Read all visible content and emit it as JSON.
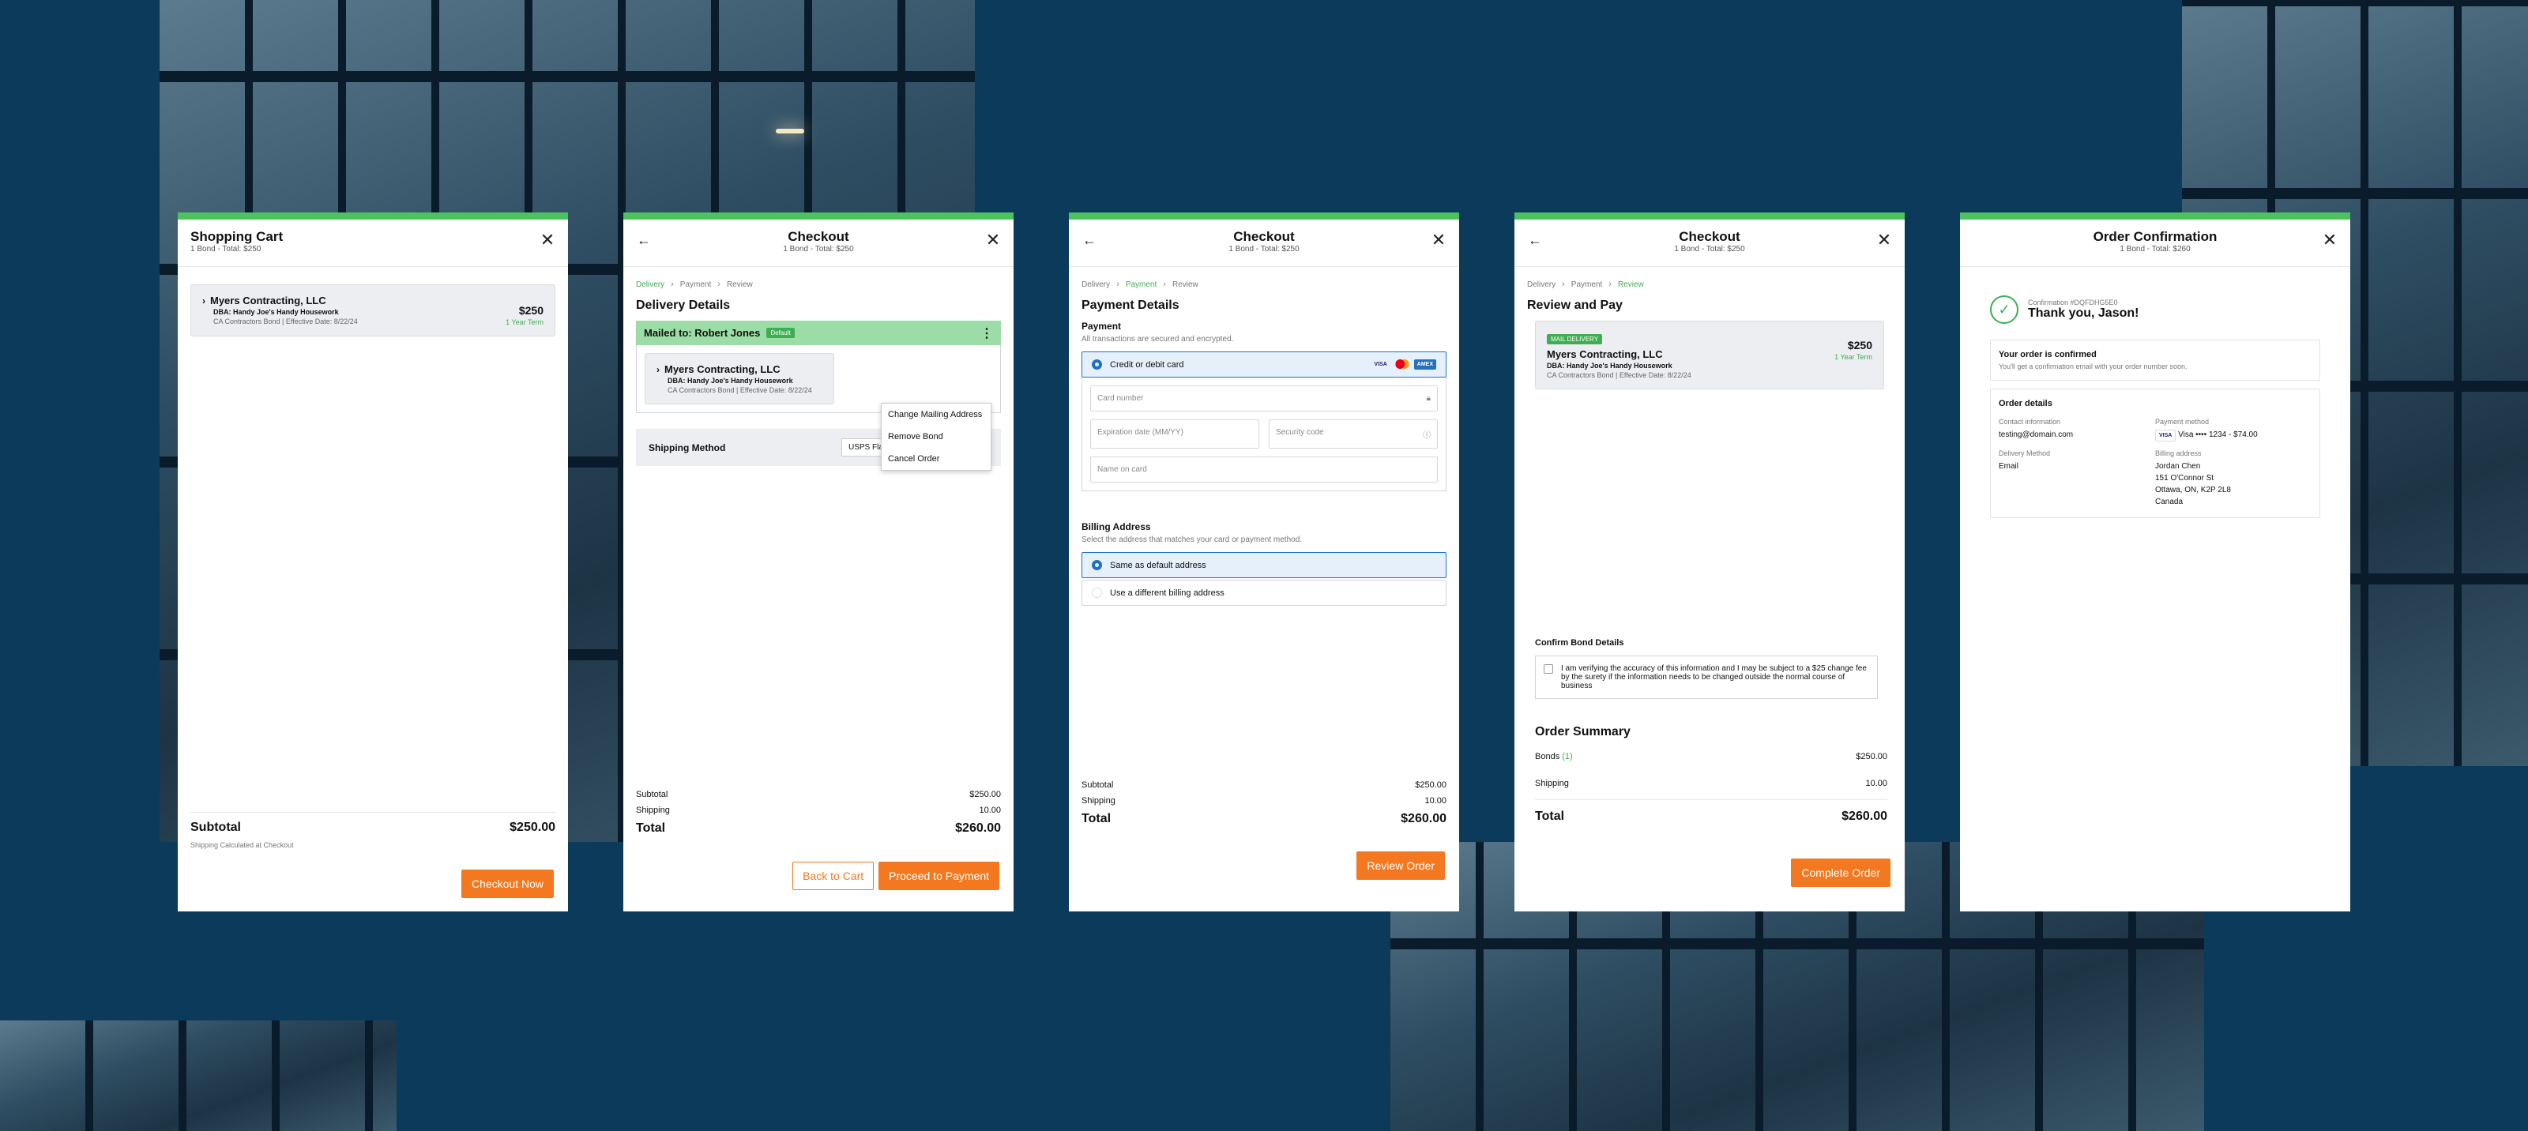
{
  "cart": {
    "title": "Shopping Cart",
    "subtitle": "1 Bond - Total: $250",
    "bond": {
      "name": "Myers Contracting, LLC",
      "dba": "DBA: Handy Joe's Handy Housework",
      "meta": "CA Contractors Bond | Effective Date: 8/22/24",
      "price": "$250",
      "term": "1 Year Term"
    },
    "subtotal_label": "Subtotal",
    "subtotal": "$250.00",
    "shipping_note": "Shipping Calculated at Checkout",
    "checkout_button": "Checkout Now"
  },
  "delivery": {
    "title": "Checkout",
    "subtitle": "1 Bond - Total: $250",
    "crumbs": [
      "Delivery",
      "Payment",
      "Review"
    ],
    "heading": "Delivery Details",
    "mailed_to": "Mailed to: Robert Jones",
    "default_badge": "Default",
    "menu": [
      "Change Mailing Address",
      "Remove Bond",
      "Cancel Order"
    ],
    "bond": {
      "name": "Myers Contracting, LLC",
      "dba": "DBA: Handy Joe's Handy Housework",
      "meta": "CA Contractors Bond | Effective Date: 8/22/24"
    },
    "shipping_label": "Shipping Method",
    "shipping_value": "USPS Flat Rate: $10.00",
    "subtotal_label": "Subtotal",
    "subtotal": "$250.00",
    "shipping_row": "Shipping",
    "shipping": "10.00",
    "total_label": "Total",
    "total": "$260.00",
    "back_button": "Back to Cart",
    "next_button": "Proceed to Payment"
  },
  "payment": {
    "title": "Checkout",
    "subtitle": "1 Bond - Total: $250",
    "crumbs": [
      "Delivery",
      "Payment",
      "Review"
    ],
    "heading": "Payment Details",
    "payment_label": "Payment",
    "secure_note": "All transactions are secured and encrypted.",
    "method": "Credit or debit card",
    "card_logos": [
      "VISA",
      "MC",
      "AMEX"
    ],
    "card_number": "Card number",
    "expiration": "Expiration date (MM/YY)",
    "security": "Security code",
    "name_on_card": "Name on card",
    "billing_heading": "Billing Address",
    "billing_note": "Select the address that matches your card or payment method.",
    "billing_same": "Same as default address",
    "billing_diff": "Use a different billing address",
    "subtotal_label": "Subtotal",
    "subtotal": "$250.00",
    "shipping_row": "Shipping",
    "shipping": "10.00",
    "total_label": "Total",
    "total": "$260.00",
    "next_button": "Review Order"
  },
  "review": {
    "title": "Checkout",
    "subtitle": "1 Bond - Total: $250",
    "crumbs": [
      "Delivery",
      "Payment",
      "Review"
    ],
    "heading": "Review and Pay",
    "badge": "MAIL DELIVERY",
    "bond": {
      "name": "Myers Contracting, LLC",
      "dba": "DBA: Handy Joe's Handy Housework",
      "meta": "CA Contractors Bond | Effective Date: 8/22/24",
      "price": "$250",
      "term": "1 Year Term"
    },
    "confirm_heading": "Confirm Bond Details",
    "confirm_text": "I am verifying the accuracy of this information and I may be subject to a $25 change fee by the surety if the information needs to be changed outside the normal course of business",
    "summary_heading": "Order Summary",
    "bonds_label": "Bonds",
    "bonds_count": "(1)",
    "bonds_value": "$250.00",
    "shipping_row": "Shipping",
    "shipping": "10.00",
    "total_label": "Total",
    "total": "$260.00",
    "complete_button": "Complete Order"
  },
  "confirm": {
    "title": "Order Confirmation",
    "subtitle": "1 Bond - Total: $260",
    "confirmation": "Confirmation #DQFDHG5E0",
    "thanks": "Thank you, Jason!",
    "confirmed_title": "Your order is confirmed",
    "confirmed_text": "You'll get a confirmation email with your order number soon.",
    "details_title": "Order details",
    "contact_label": "Contact information",
    "contact_value": "testing@domain.com",
    "payment_label": "Payment method",
    "payment_value": "Visa •••• 1234 - $74.00",
    "payment_brand": "VISA",
    "delivery_label": "Delivery Method",
    "delivery_value": "Email",
    "billing_label": "Billing address",
    "billing_lines": [
      "Jordan Chen",
      "151 O'Connor St",
      "Ottawa, ON, K2P 2L8",
      "Canada"
    ]
  }
}
